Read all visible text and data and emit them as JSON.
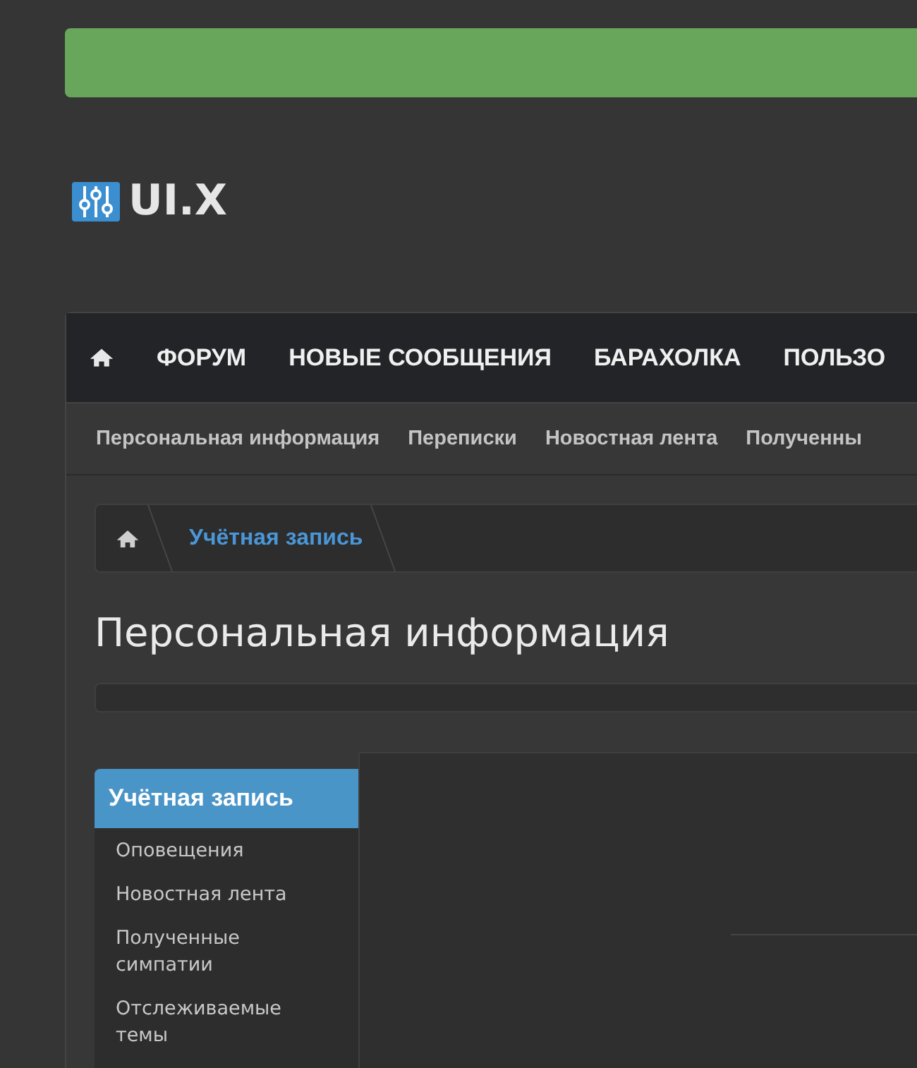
{
  "logo": {
    "text": "UI.X"
  },
  "nav": {
    "items": [
      "ФОРУМ",
      "НОВЫЕ СООБЩЕНИЯ",
      "БАРАХОЛКА",
      "ПОЛЬЗО"
    ]
  },
  "subnav": {
    "items": [
      "Персональная информация",
      "Переписки",
      "Новостная лента",
      "Полученны"
    ]
  },
  "breadcrumb": {
    "items": [
      "Учётная запись"
    ]
  },
  "page_title": "Персональная информация",
  "sidebar": {
    "heading": "Учётная запись",
    "items": [
      "Оповещения",
      "Новостная лента",
      "Полученные симпатии",
      "Отслеживаемые темы"
    ]
  }
}
